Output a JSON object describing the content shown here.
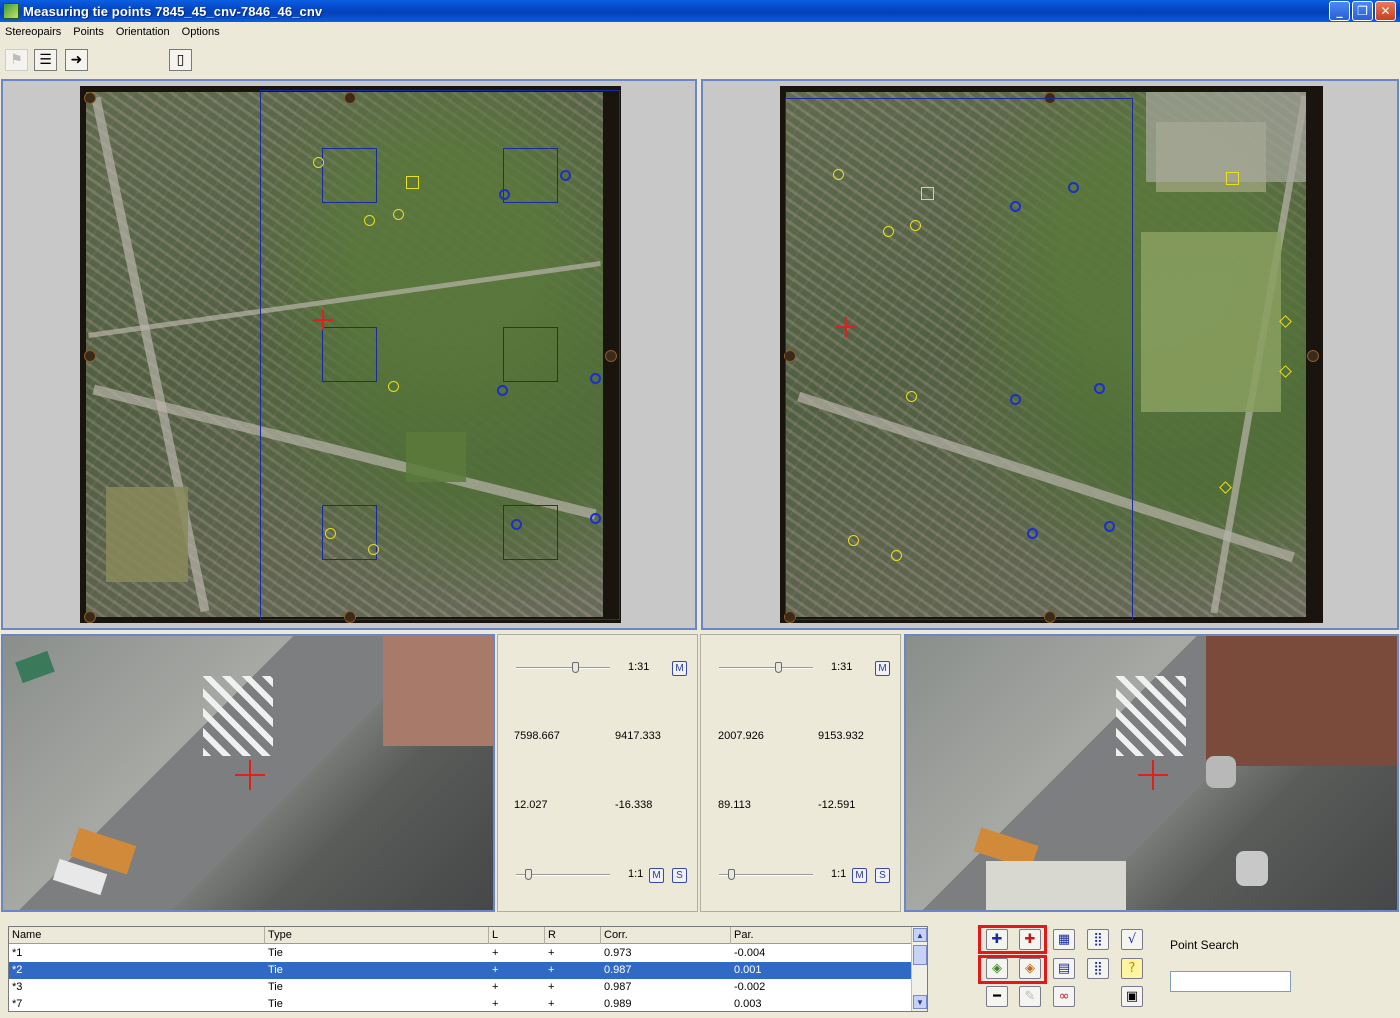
{
  "window": {
    "title": "Measuring tie points 7845_45_cnv-7846_46_cnv",
    "minimize": "_",
    "restore": "❐",
    "close": "✕"
  },
  "menu": [
    {
      "label": "Stereopairs"
    },
    {
      "label": "Points"
    },
    {
      "label": "Orientation"
    },
    {
      "label": "Options"
    }
  ],
  "toolbar": {
    "icons": [
      "flag-icon",
      "list-icon",
      "arrow-right-icon",
      "door-icon"
    ]
  },
  "left_info": {
    "zoom_top": "1:31",
    "m1": "M",
    "x": "7598.667",
    "y": "9417.333",
    "dx": "12.027",
    "dy": "-16.338",
    "zoom_bottom": "1:1",
    "m2": "M",
    "s": "S"
  },
  "right_info": {
    "zoom_top": "1:31",
    "m1": "M",
    "x": "2007.926",
    "y": "9153.932",
    "dx": "89.113",
    "dy": "-12.591",
    "zoom_bottom": "1:1",
    "m2": "M",
    "s": "S"
  },
  "table": {
    "columns": [
      "Name",
      "Type",
      "L",
      "R",
      "Corr.",
      "Par."
    ],
    "rows": [
      {
        "name": "*1",
        "type": "Tie",
        "l": "+",
        "r": "+",
        "corr": "0.973",
        "par": "-0.004",
        "selected": false
      },
      {
        "name": "*2",
        "type": "Tie",
        "l": "+",
        "r": "+",
        "corr": "0.987",
        "par": "0.001",
        "selected": true
      },
      {
        "name": "*3",
        "type": "Tie",
        "l": "+",
        "r": "+",
        "corr": "0.987",
        "par": "-0.002",
        "selected": false
      },
      {
        "name": "*7",
        "type": "Tie",
        "l": "+",
        "r": "+",
        "corr": "0.989",
        "par": "0.003",
        "selected": false
      }
    ]
  },
  "point_search": {
    "label": "Point Search",
    "value": ""
  },
  "colors": {
    "selection": "#316ac5",
    "panel_border": "#6b86c8",
    "highlight": "#e01a1a"
  }
}
